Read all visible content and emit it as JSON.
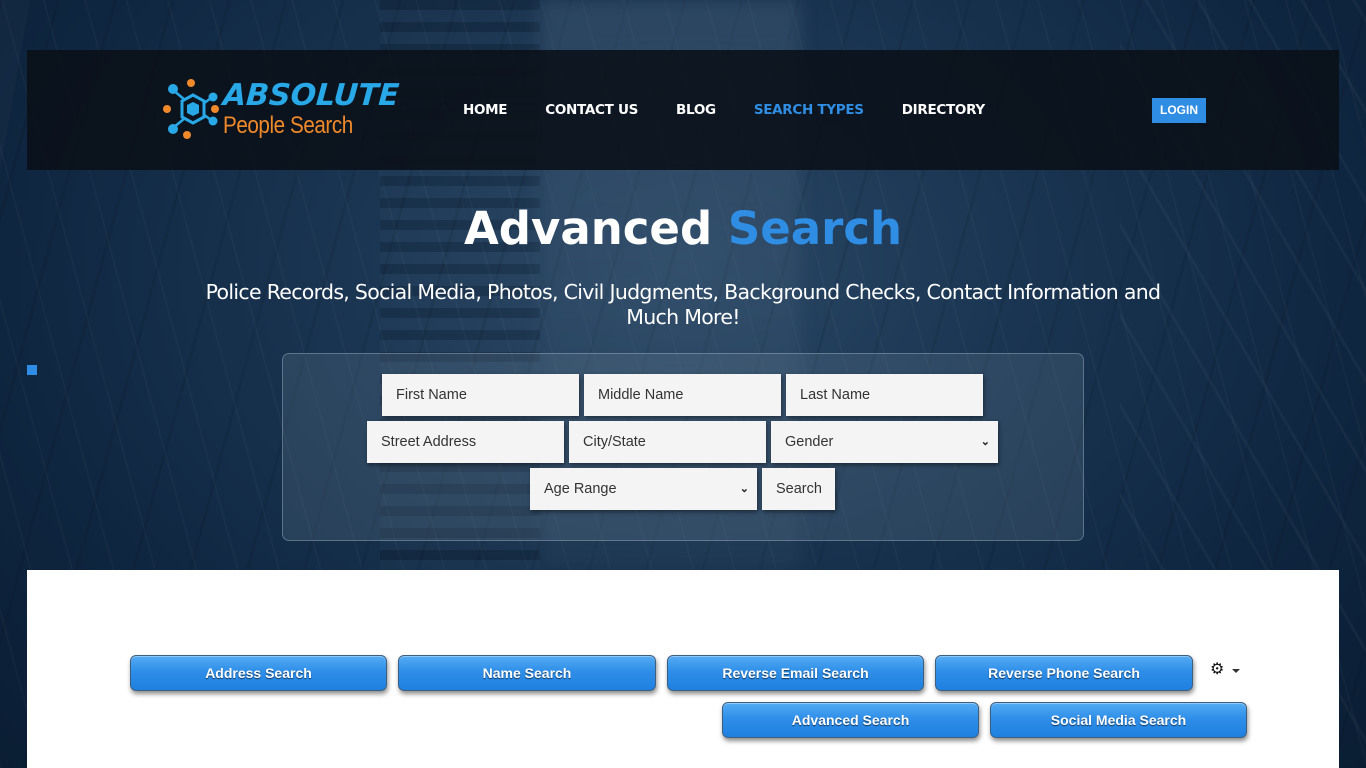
{
  "header": {
    "logo": {
      "line1": "ABSOLUTE",
      "line2": "People Search",
      "colors": {
        "primary": "#29a8e8",
        "secondary": "#f0892a"
      }
    },
    "nav": [
      {
        "label": "HOME",
        "active": false
      },
      {
        "label": "CONTACT US",
        "active": false
      },
      {
        "label": "BLOG",
        "active": false
      },
      {
        "label": "SEARCH TYPES",
        "active": true
      },
      {
        "label": "DIRECTORY",
        "active": false
      }
    ],
    "login_label": "LOGIN"
  },
  "hero": {
    "title_main": "Advanced",
    "title_accent": "Search",
    "subtitle": "Police Records, Social Media, Photos, Civil Judgments, Background Checks, Contact Information and Much More!"
  },
  "search_form": {
    "first_name_placeholder": "First Name",
    "middle_name_placeholder": "Middle Name",
    "last_name_placeholder": "Last Name",
    "street_address_placeholder": "Street Address",
    "city_state_placeholder": "City/State",
    "gender_selected": "Gender",
    "age_range_selected": "Age Range",
    "search_label": "Search"
  },
  "search_type_buttons": [
    {
      "label": "Address Search"
    },
    {
      "label": "Name Search"
    },
    {
      "label": "Reverse Email Search"
    },
    {
      "label": "Reverse Phone Search"
    },
    {
      "label": "Advanced Search"
    },
    {
      "label": "Social Media Search"
    }
  ],
  "settings_menu": {
    "icon": "gear-icon"
  },
  "accent_color": "#2f8ee3"
}
